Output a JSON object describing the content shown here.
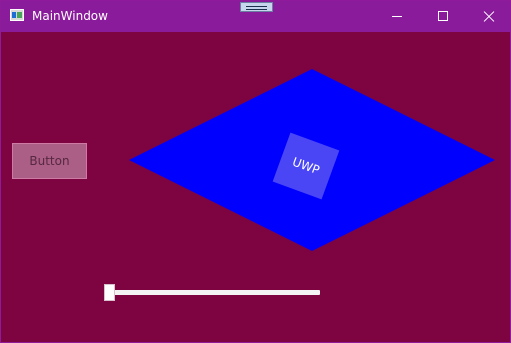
{
  "window": {
    "title": "MainWindow",
    "accent_color": "#8a1b9a",
    "background_color": "#7e0341",
    "controls": {
      "minimize_icon": "minimize-icon",
      "maximize_icon": "maximize-icon",
      "close_icon": "close-icon"
    }
  },
  "toolbar": {
    "debug_tool_icon": "window-debug-toolbar-icon"
  },
  "main": {
    "button_label": "Button",
    "diamond_color": "#0000ff",
    "uwp_label": "UWP",
    "uwp_card_color": "#4a46f6",
    "slider": {
      "value": 0,
      "track_color": "#f4f4f4",
      "thumb_color": "#ffffff"
    }
  }
}
